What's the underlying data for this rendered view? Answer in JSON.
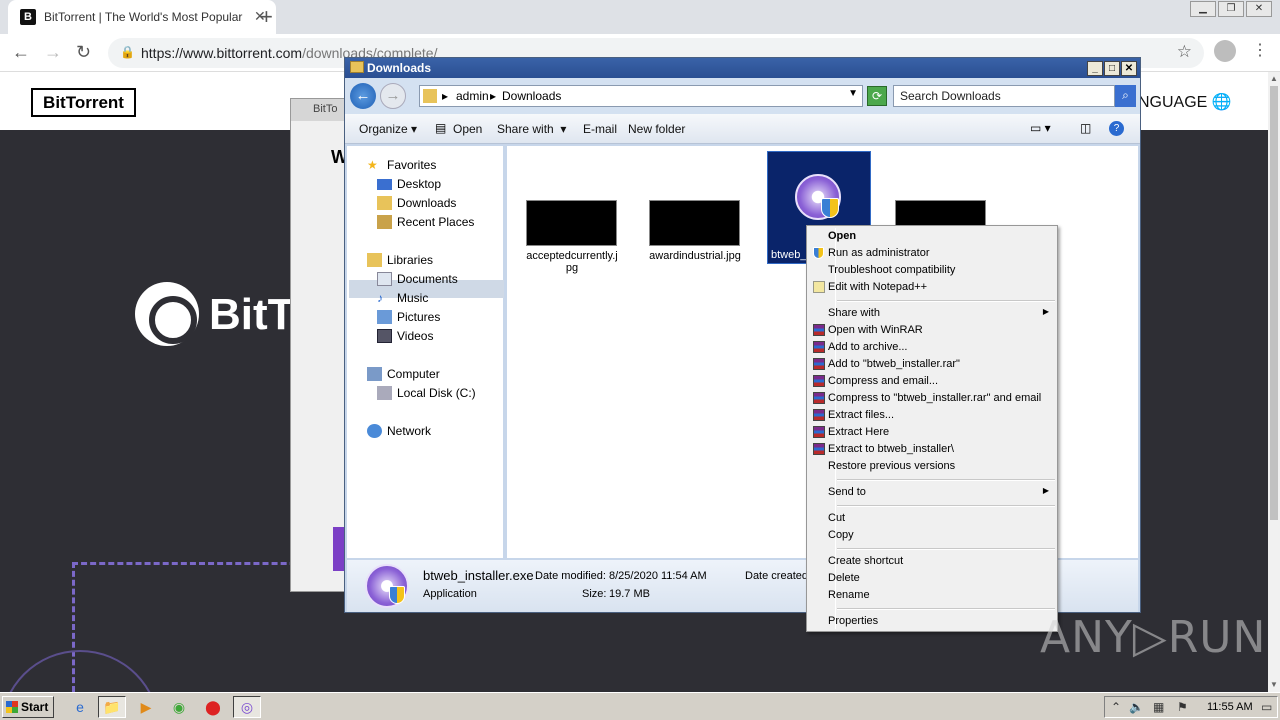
{
  "browser": {
    "tab_title": "BitTorrent | The World's Most Popular Torrent Client",
    "tab_favicon": "B",
    "url_host": "https://www.bittorrent.com",
    "url_path": "/downloads/complete/"
  },
  "site": {
    "logo": "BitTorrent",
    "language_label": "NGUAGE",
    "hero_text": "BitT",
    "behind_dialog_caption": "BitTo",
    "behind_dialog_letter": "W"
  },
  "explorer": {
    "title": "Downloads",
    "breadcrumb": [
      "admin",
      "Downloads"
    ],
    "search_placeholder": "Search Downloads",
    "toolbar": {
      "organize": "Organize",
      "open": "Open",
      "share_with": "Share with",
      "email": "E-mail",
      "new_folder": "New folder"
    },
    "nav": {
      "favorites": "Favorites",
      "desktop": "Desktop",
      "downloads": "Downloads",
      "recent_places": "Recent Places",
      "libraries": "Libraries",
      "documents": "Documents",
      "music": "Music",
      "pictures": "Pictures",
      "videos": "Videos",
      "computer": "Computer",
      "local_disk": "Local Disk (C:)",
      "network": "Network"
    },
    "files": {
      "file1_line1": "acceptedcurrently.j",
      "file1_line2": "pg",
      "file2": "awardindustrial.jpg",
      "file3_partial": "btweb_"
    },
    "details": {
      "name": "btweb_installer.exe",
      "modified_label": "Date modified:",
      "modified_value": "8/25/2020 11:54 AM",
      "created_label": "Date created:",
      "type": "Application",
      "size_label": "Size:",
      "size_value": "19.7 MB"
    }
  },
  "context_menu": {
    "open": "Open",
    "run_as_admin": "Run as administrator",
    "troubleshoot": "Troubleshoot compatibility",
    "edit_notepad": "Edit with Notepad++",
    "share_with": "Share with",
    "open_winrar": "Open with WinRAR",
    "add_archive": "Add to archive...",
    "add_to_rar": "Add to \"btweb_installer.rar\"",
    "compress_email": "Compress and email...",
    "compress_to_rar_email": "Compress to \"btweb_installer.rar\" and email",
    "extract_files": "Extract files...",
    "extract_here": "Extract Here",
    "extract_to": "Extract to btweb_installer\\",
    "restore": "Restore previous versions",
    "send_to": "Send to",
    "cut": "Cut",
    "copy": "Copy",
    "create_shortcut": "Create shortcut",
    "delete": "Delete",
    "rename": "Rename",
    "properties": "Properties"
  },
  "watermark": "ANY▷RUN",
  "taskbar": {
    "start": "Start",
    "clock": "11:55 AM"
  },
  "colors": {
    "explorer_frame": "#c7d6ea",
    "selection": "#0a246a",
    "site_dark": "#2e2e34",
    "menu_bg": "#f0f0f0"
  }
}
